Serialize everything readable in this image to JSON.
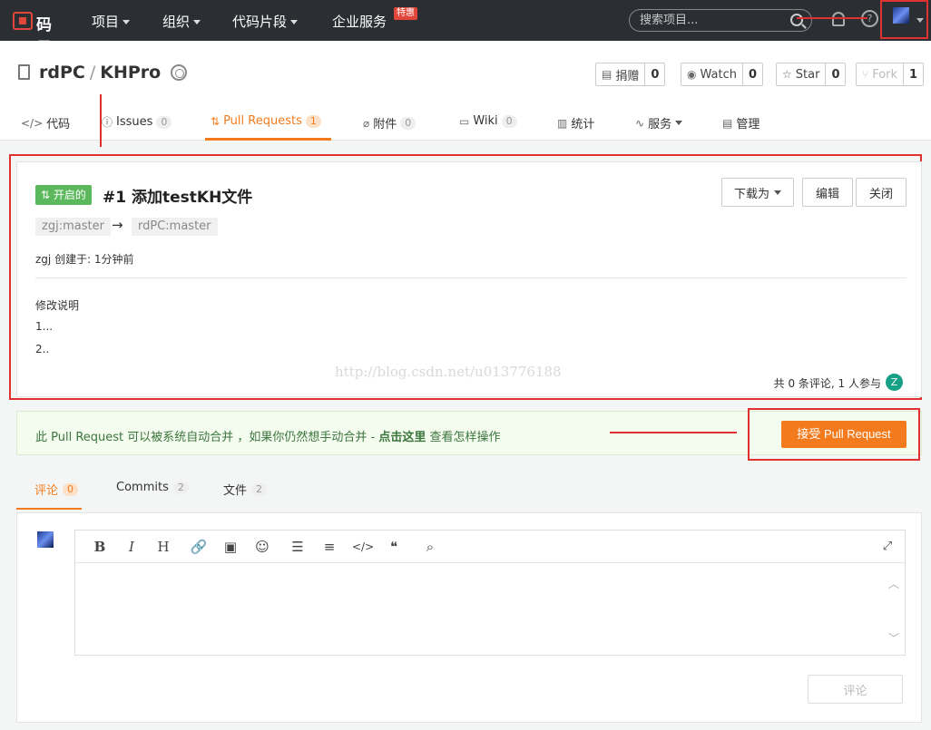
{
  "topnav": {
    "logo_text": "码云",
    "items": [
      {
        "label": "项目"
      },
      {
        "label": "组织"
      },
      {
        "label": "代码片段"
      },
      {
        "label": "企业服务"
      }
    ],
    "hot_badge": "特惠",
    "search_placeholder": "搜索项目..."
  },
  "repo": {
    "owner": "rdPC",
    "separator": "/",
    "name": "KHPro",
    "buttons": {
      "donate": {
        "label": "捐赠",
        "count": "0"
      },
      "watch": {
        "label": "Watch",
        "count": "0"
      },
      "star": {
        "label": "Star",
        "count": "0"
      },
      "fork": {
        "label": "Fork",
        "count": "1"
      }
    },
    "tabs": [
      {
        "label": "代码",
        "count": ""
      },
      {
        "label": "Issues",
        "count": "0"
      },
      {
        "label": "Pull Requests",
        "count": "1"
      },
      {
        "label": "附件",
        "count": "0"
      },
      {
        "label": "Wiki",
        "count": "0"
      },
      {
        "label": "统计",
        "count": ""
      },
      {
        "label": "服务",
        "count": ""
      },
      {
        "label": "管理",
        "count": ""
      }
    ]
  },
  "pr": {
    "state": "开启的",
    "title": "#1 添加testKH文件",
    "download_label": "下载为",
    "edit_label": "编辑",
    "close_label": "关闭",
    "source_branch": "zgj:master",
    "arrow": "→",
    "target_branch": "rdPC:master",
    "created": "zgj 创建于: 1分钟前",
    "description": [
      "修改说明",
      "1...",
      "2.."
    ],
    "watermark": "http://blog.csdn.net/u013776188",
    "comment_summary": "共 0 条评论, 1 人参与",
    "participant_initial": "Z"
  },
  "merge": {
    "text_before": "此 Pull Request 可以被系统自动合并 ，如果你仍然想手动合并 - ",
    "link": "点击这里",
    "text_after": " 查看怎样操作",
    "accept_label": "接受 Pull Request"
  },
  "bottom_tabs": [
    {
      "label": "评论",
      "count": "0"
    },
    {
      "label": "Commits",
      "count": "2"
    },
    {
      "label": "文件",
      "count": "2"
    }
  ],
  "editor": {
    "tools": [
      "B",
      "I",
      "H",
      "🔗",
      "▣",
      "☺",
      "☰",
      "≡",
      "</>",
      "❝",
      "⌕"
    ],
    "submit_label": "评论"
  },
  "colors": {
    "accent": "#f37b1d",
    "nav_bg": "#2b2e33",
    "open_badge": "#5cb85c",
    "annotation_red": "#e03131"
  }
}
